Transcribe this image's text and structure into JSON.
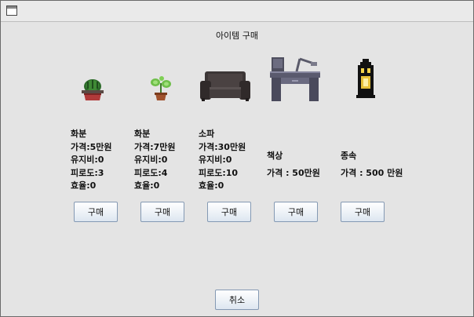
{
  "window": {
    "title": ""
  },
  "dialog": {
    "title": "아이템 구매",
    "cancel_label": "취소"
  },
  "items": [
    {
      "icon": "potted-cactus-icon",
      "lines": [
        "화분",
        "가격:5만원",
        "유지비:0",
        "피로도:3",
        "효율:0"
      ],
      "buy_label": "구매"
    },
    {
      "icon": "potted-sprout-icon",
      "lines": [
        "화분",
        "가격:7만원",
        "유지비:0",
        "피로도:4",
        "효율:0"
      ],
      "buy_label": "구매"
    },
    {
      "icon": "sofa-icon",
      "lines": [
        "소파",
        "가격:30만원",
        "유지비:0",
        "피로도:10",
        "효율:0"
      ],
      "buy_label": "구매"
    },
    {
      "icon": "desk-lamp-icon",
      "lines": [
        "책상",
        "가격 : 50만원"
      ],
      "buy_label": "구매"
    },
    {
      "icon": "lantern-icon",
      "lines": [
        "종속",
        "가격 : 500 만원"
      ],
      "buy_label": "구매"
    }
  ]
}
